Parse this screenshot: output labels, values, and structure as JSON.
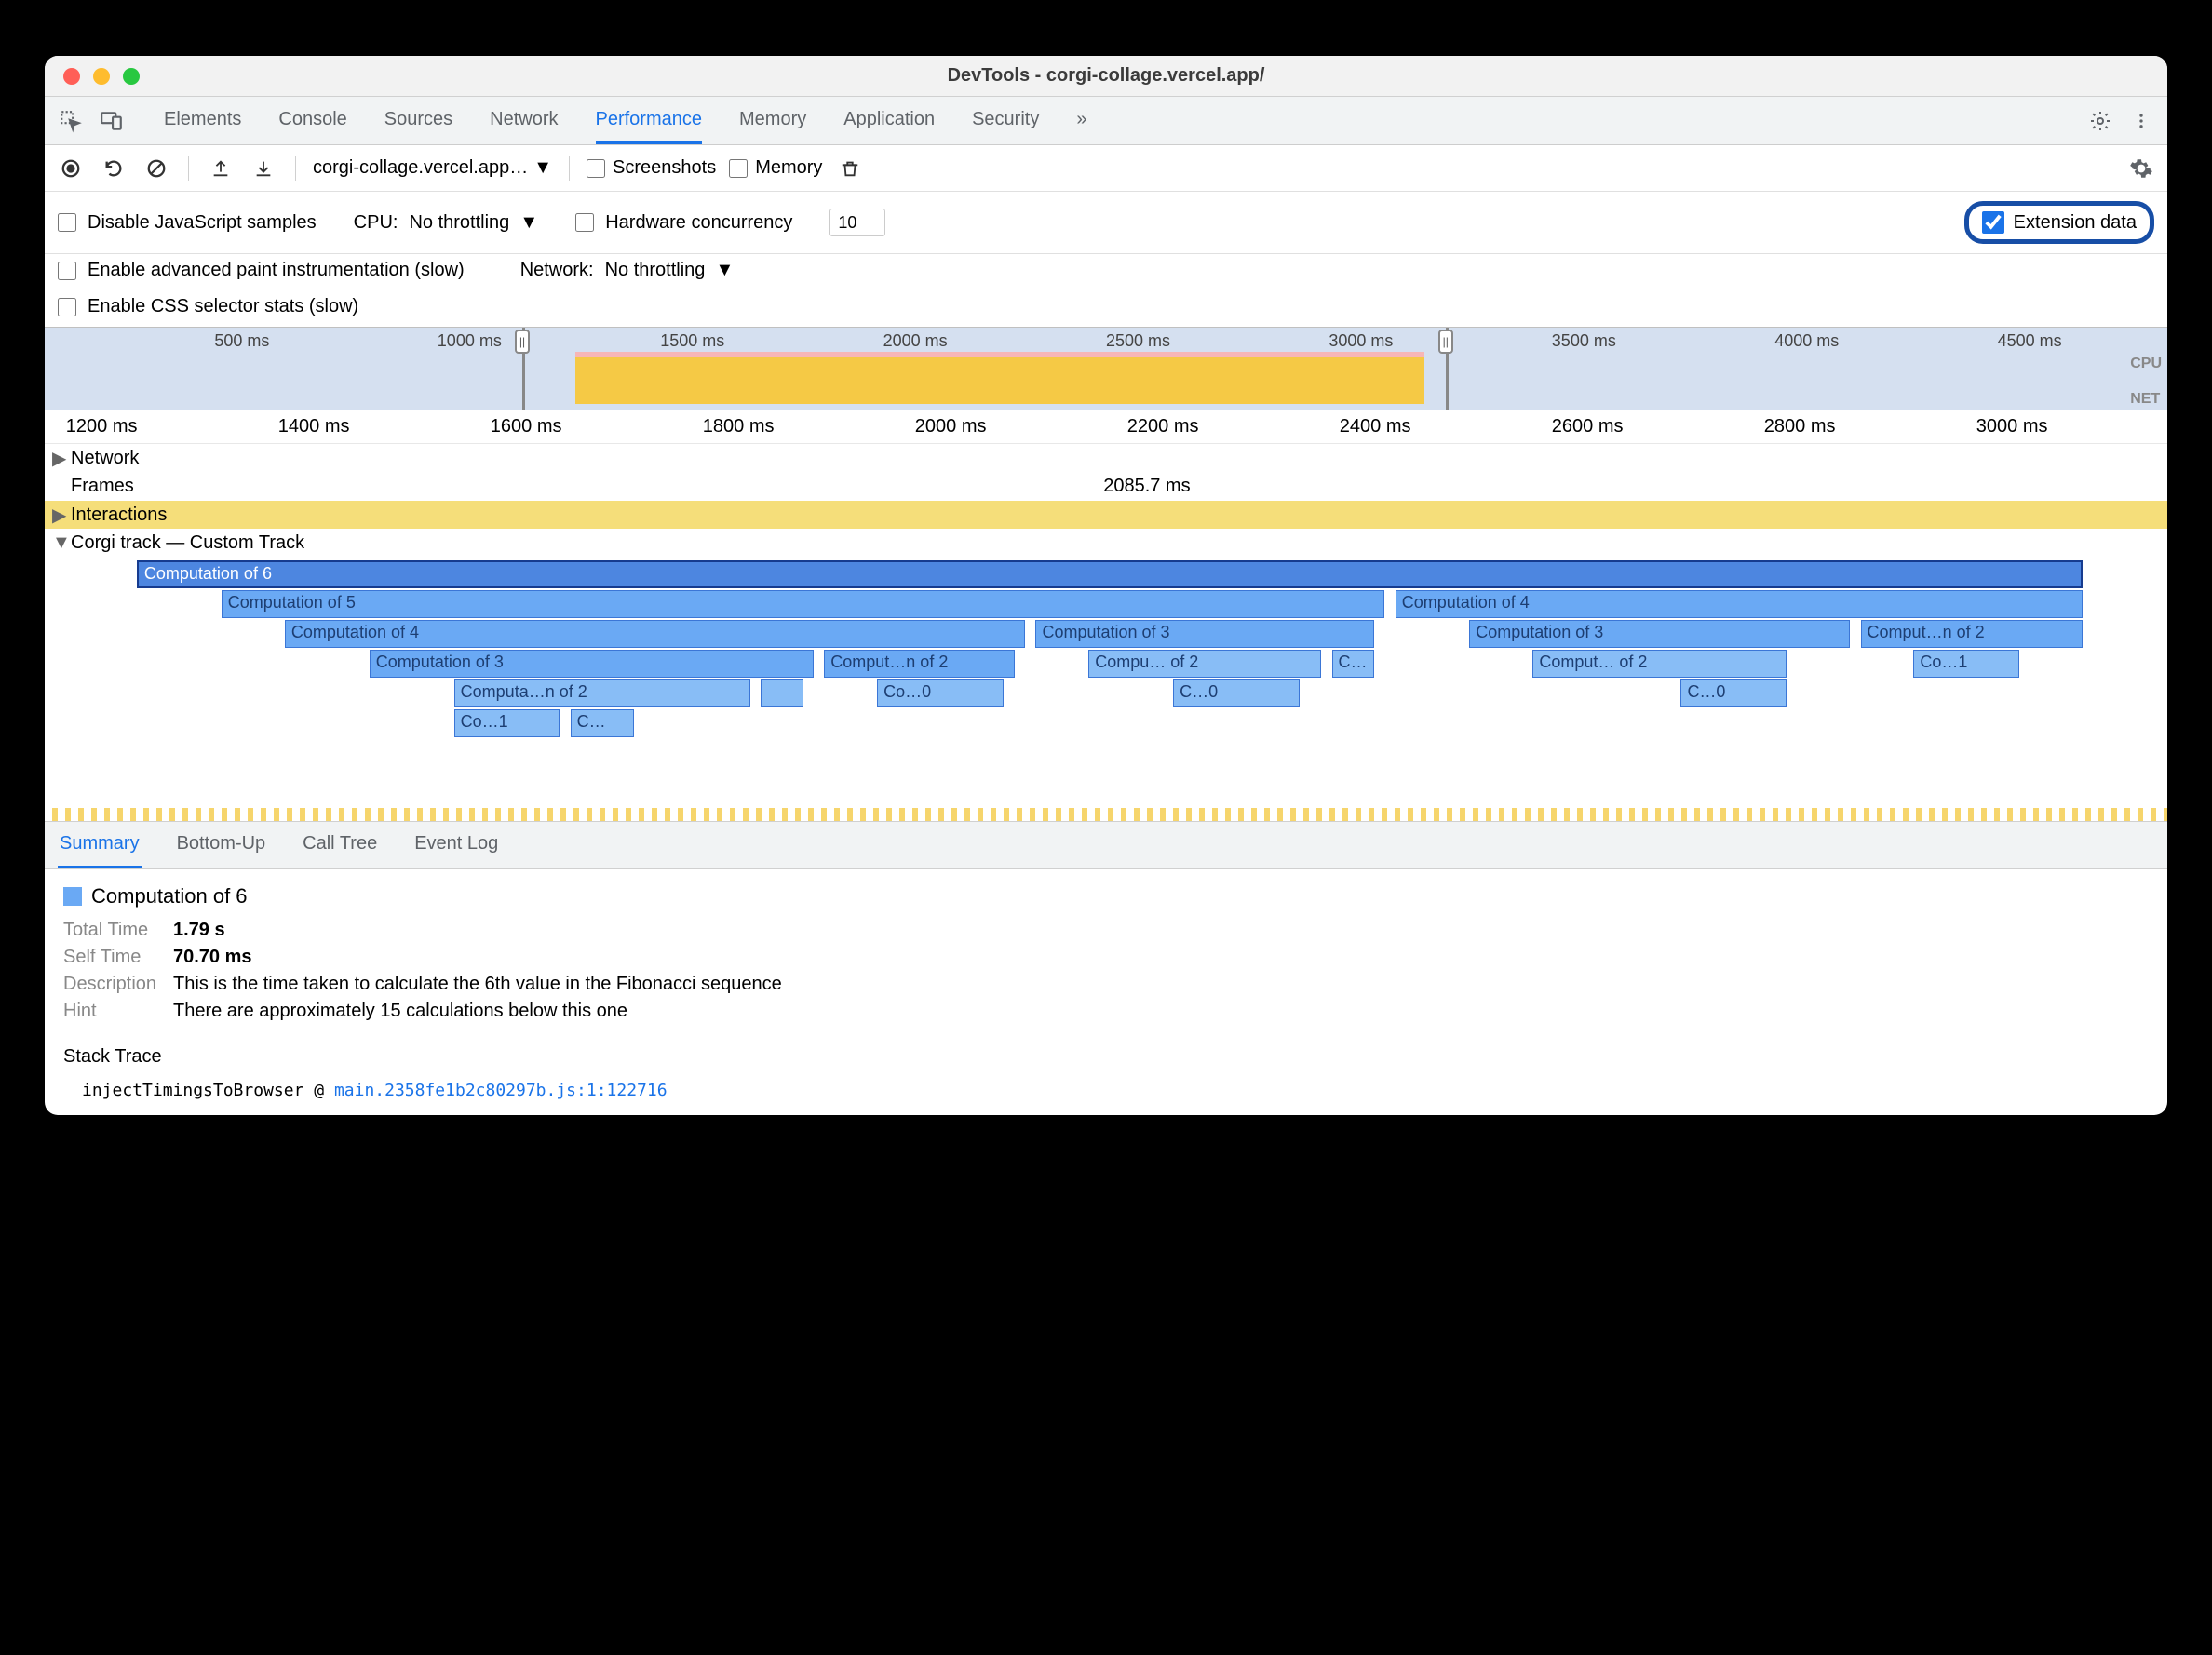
{
  "window": {
    "title": "DevTools - corgi-collage.vercel.app/"
  },
  "tabs": {
    "t0": "Elements",
    "t1": "Console",
    "t2": "Sources",
    "t3": "Network",
    "t4": "Performance",
    "t5": "Memory",
    "t6": "Application",
    "t7": "Security",
    "more": "»"
  },
  "toolbar": {
    "url": "corgi-collage.vercel.app…",
    "screenshots": "Screenshots",
    "memory": "Memory"
  },
  "options": {
    "disableJs": "Disable JavaScript samples",
    "cpuLabel": "CPU:",
    "cpuValue": "No throttling",
    "hardware": "Hardware concurrency",
    "hwValue": "10",
    "extension": "Extension data",
    "advPaint": "Enable advanced paint instrumentation (slow)",
    "netLabel": "Network:",
    "netValue": "No throttling",
    "cssStats": "Enable CSS selector stats (slow)"
  },
  "overview": {
    "ticks": [
      "500 ms",
      "1000 ms",
      "1500 ms",
      "2000 ms",
      "2500 ms",
      "3000 ms",
      "3500 ms",
      "4000 ms",
      "4500 ms"
    ],
    "right": [
      "CPU",
      "NET"
    ]
  },
  "ruler": [
    "1200 ms",
    "1400 ms",
    "1600 ms",
    "1800 ms",
    "2000 ms",
    "2200 ms",
    "2400 ms",
    "2600 ms",
    "2800 ms",
    "3000 ms"
  ],
  "tracks": {
    "network": "Network",
    "frames": "Frames",
    "framesVal": "2085.7 ms",
    "interactions": "Interactions",
    "custom": "Corgi track — Custom Track"
  },
  "bars": {
    "l0": "Computation of 6",
    "l1a": "Computation of 5",
    "l1b": "Computation of 4",
    "l2a": "Computation of 4",
    "l2b": "Computation of 3",
    "l2c": "Computation of 3",
    "l2d": "Comput…n of 2",
    "l3a": "Computation of 3",
    "l3b": "Comput…n of 2",
    "l3c": "Compu… of 2",
    "l3d": "C…",
    "l3e": "Comput… of 2",
    "l3f": "Co…1",
    "l4a": "Computa…n of 2",
    "l4b": "Co…0",
    "l4c": "C…0",
    "l4d": "C…0",
    "l5a": "Co…1",
    "l5b": "C…"
  },
  "detailTabs": {
    "d0": "Summary",
    "d1": "Bottom-Up",
    "d2": "Call Tree",
    "d3": "Event Log"
  },
  "summary": {
    "title": "Computation of 6",
    "totalTimeLabel": "Total Time",
    "totalTime": "1.79 s",
    "selfTimeLabel": "Self Time",
    "selfTime": "70.70 ms",
    "descLabel": "Description",
    "desc": "This is the time taken to calculate the 6th value in the Fibonacci sequence",
    "hintLabel": "Hint",
    "hint": "There are approximately 15 calculations below this one",
    "stackTitle": "Stack Trace",
    "stackFn": "injectTimingsToBrowser @ ",
    "stackLink": "main.2358fe1b2c80297b.js:1:122716"
  }
}
